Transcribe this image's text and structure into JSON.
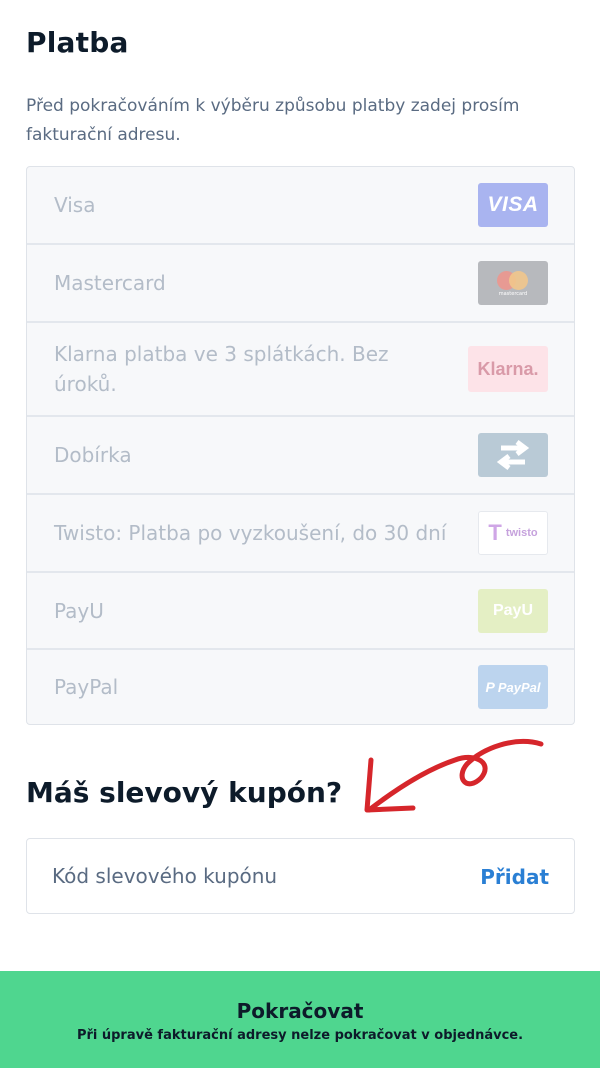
{
  "page": {
    "title": "Platba",
    "intro": "Před pokračováním k výběru způsobu platby zadej prosím fakturační adresu."
  },
  "payment_methods": [
    {
      "label": "Visa",
      "logo_icon": "visa-logo-icon",
      "logo_text": "VISA"
    },
    {
      "label": "Mastercard",
      "logo_icon": "mastercard-logo-icon",
      "logo_text": "mastercard"
    },
    {
      "label": "Klarna platba ve 3 splátkách. Bez úroků.",
      "logo_icon": "klarna-logo-icon",
      "logo_text": "Klarna."
    },
    {
      "label": "Dobírka",
      "logo_icon": "exchange-arrows-icon"
    },
    {
      "label": "Twisto: Platba po vyzkoušení, do 30 dní",
      "logo_icon": "twisto-logo-icon",
      "logo_text": "twisto"
    },
    {
      "label": "PayU",
      "logo_icon": "payu-logo-icon",
      "logo_text": "PayU"
    },
    {
      "label": "PayPal",
      "logo_icon": "paypal-logo-icon",
      "logo_text": "PayPal"
    }
  ],
  "coupon": {
    "title": "Máš slevový kupón?",
    "placeholder": "Kód slevového kupónu",
    "value": "",
    "add_label": "Přidat"
  },
  "continue_button": {
    "label": "Pokračovat",
    "note": "Při úpravě fakturační adresy nelze pokračovat v objednávce."
  },
  "colors": {
    "accent_green": "#4fd68f",
    "link_blue": "#2a7fd4",
    "annotation_red": "#d6262b",
    "text_dark": "#0d1b2a",
    "text_muted": "#5a6b82"
  },
  "icons": {
    "annotation_arrow": "red-curved-arrow-icon"
  }
}
